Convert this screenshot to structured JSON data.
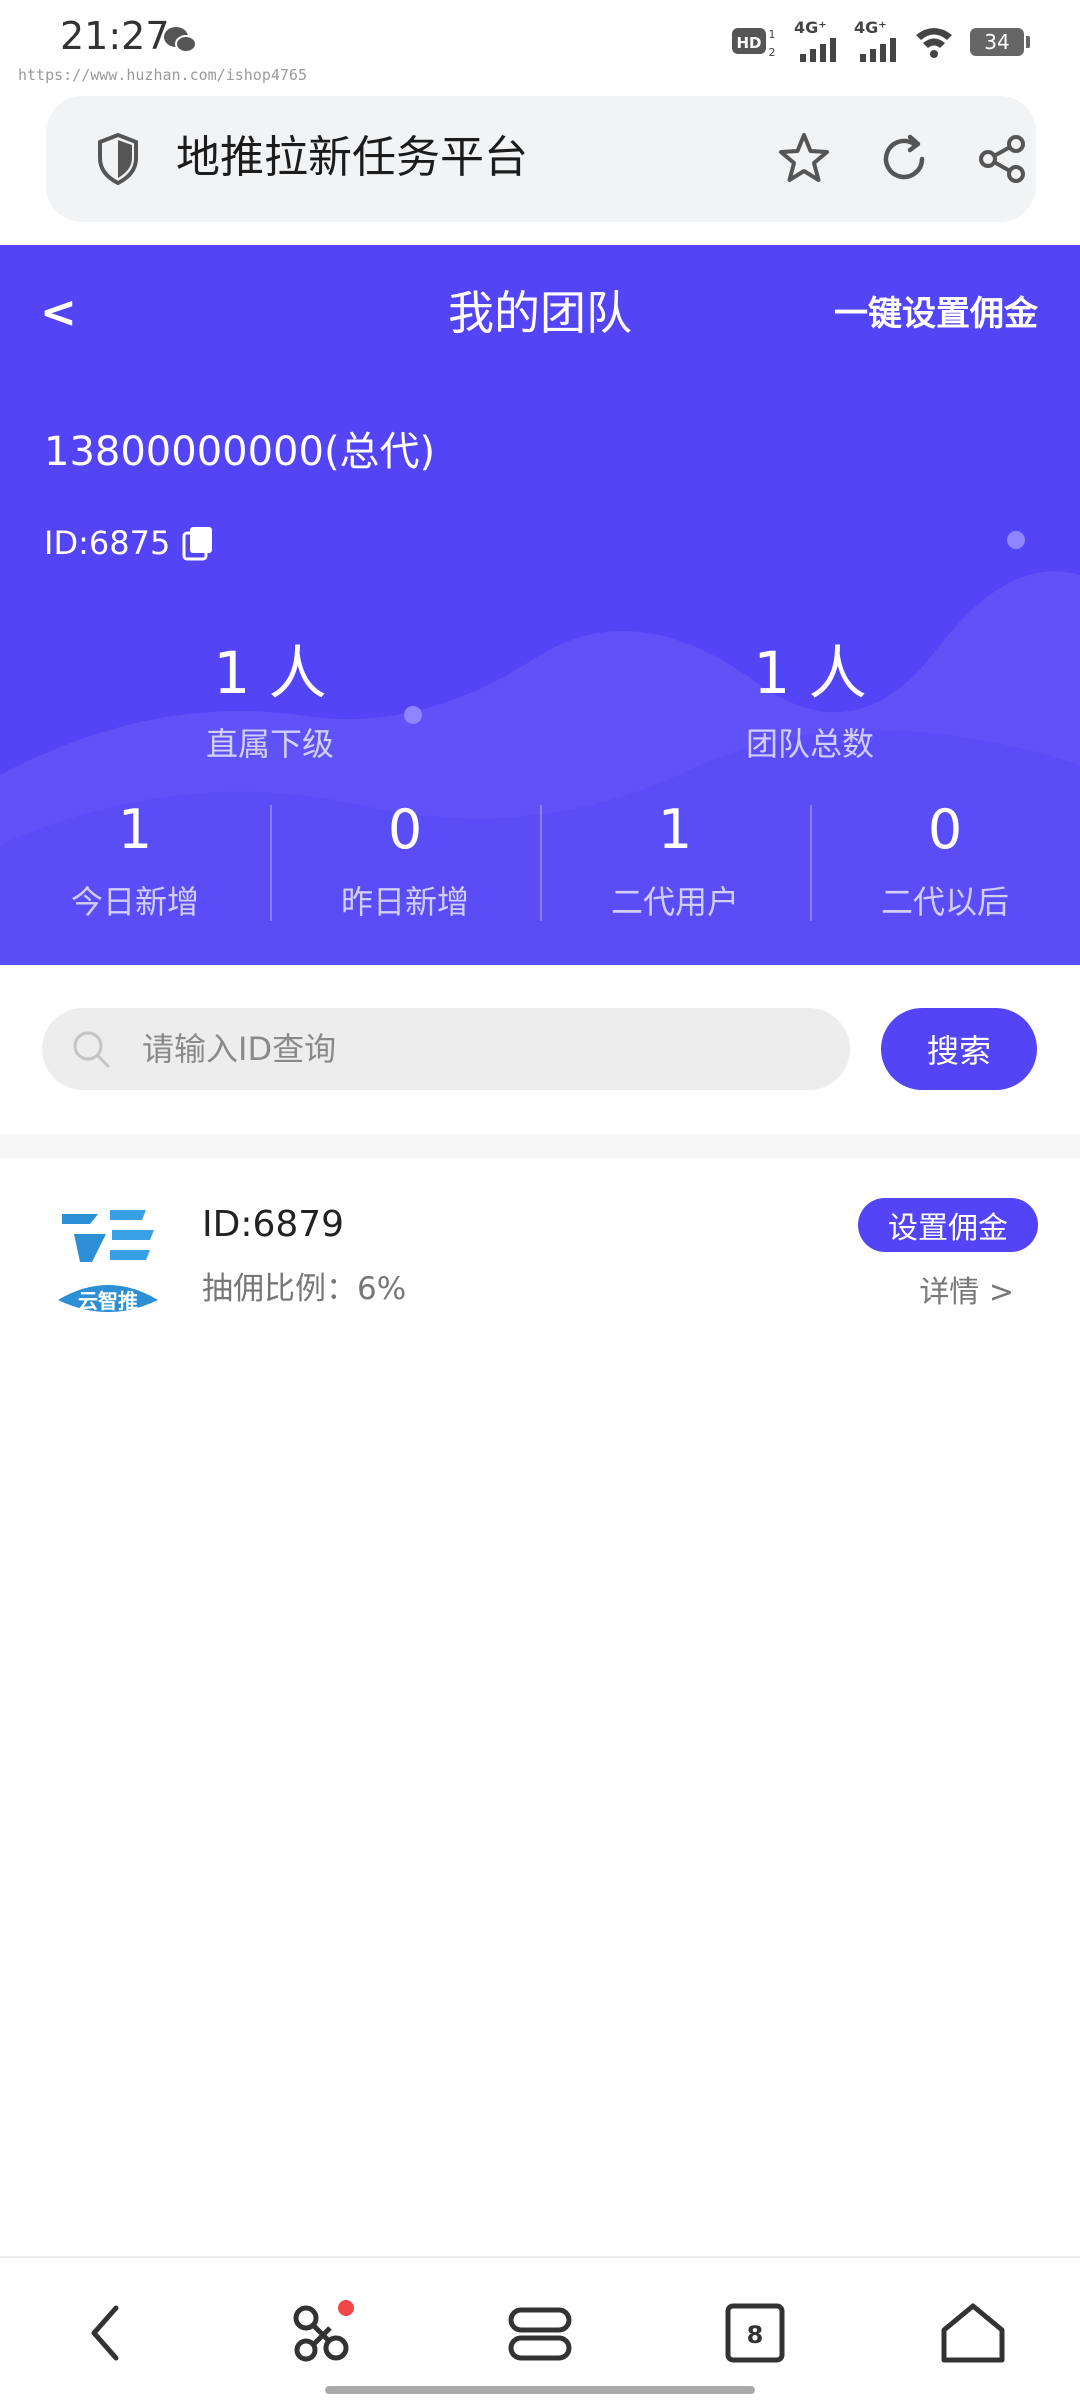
{
  "status_bar": {
    "time": "21:27",
    "network_1": "4G⁺",
    "network_2": "4G⁺",
    "battery": "34",
    "hd_badge": "HD"
  },
  "watermark": "https://www.huzhan.com/ishop4765",
  "browser": {
    "page_title": "地推拉新任务平台",
    "icons": [
      "shield-icon",
      "star-icon",
      "refresh-icon",
      "share-icon"
    ]
  },
  "header": {
    "back_label": "<",
    "title": "我的团队",
    "set_all_commission": "一键设置佣金",
    "account_name": "13800000000(总代)",
    "account_id": "ID:6875"
  },
  "summary": [
    {
      "value": "1 人",
      "label": "直属下级"
    },
    {
      "value": "1 人",
      "label": "团队总数"
    }
  ],
  "stats": [
    {
      "value": "1",
      "label": "今日新增"
    },
    {
      "value": "0",
      "label": "昨日新增"
    },
    {
      "value": "1",
      "label": "二代用户"
    },
    {
      "value": "0",
      "label": "二代以后"
    }
  ],
  "search": {
    "placeholder": "请输入ID查询",
    "value": "",
    "button_label": "搜索"
  },
  "members": [
    {
      "id": "ID:6879",
      "rate": "抽佣比例：6%",
      "set_button": "设置佣金",
      "details": "详情 >",
      "logo_text": "云智推"
    }
  ],
  "bottom_nav": {
    "tabs_count": "8",
    "icons": [
      "back-icon",
      "apps-icon",
      "menu-icon",
      "tabs-icon",
      "home-icon"
    ]
  },
  "colors": {
    "accent": "#5344f5",
    "wave": "#6a5cf7",
    "text_muted": "#777777"
  }
}
